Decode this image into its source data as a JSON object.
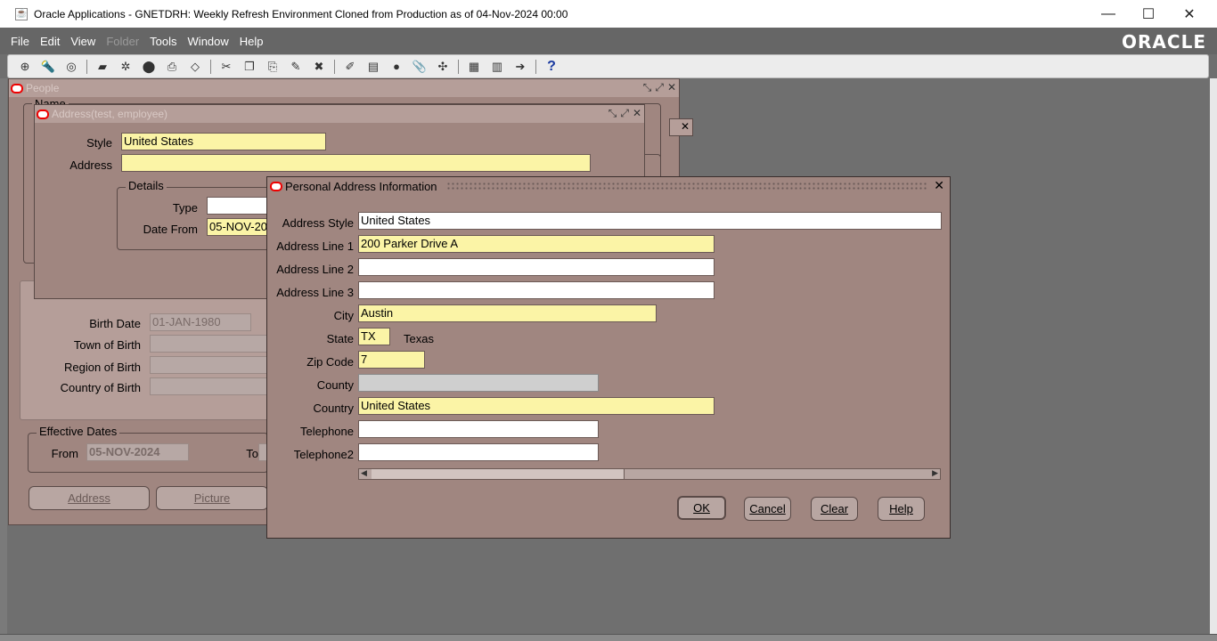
{
  "window": {
    "title": "Oracle Applications - GNETDRH: Weekly Refresh Environment Cloned from Production as of 04-Nov-2024 00:00",
    "minimize": "—",
    "maximize": "☐",
    "close": "✕"
  },
  "menu": {
    "items": [
      {
        "label": "File",
        "enabled": true
      },
      {
        "label": "Edit",
        "enabled": true
      },
      {
        "label": "View",
        "enabled": true
      },
      {
        "label": "Folder",
        "enabled": false
      },
      {
        "label": "Tools",
        "enabled": true
      },
      {
        "label": "Window",
        "enabled": true
      },
      {
        "label": "Help",
        "enabled": true
      }
    ],
    "logo": "ORACLE"
  },
  "people_window": {
    "title": "People",
    "name_label": "Name",
    "birth_date_label": "Birth Date",
    "birth_date_value": "01-JAN-1980",
    "town_of_birth_label": "Town of Birth",
    "region_of_birth_label": "Region of Birth",
    "country_of_birth_label": "Country of Birth",
    "effective_dates_label": "Effective Dates",
    "from_label": "From",
    "from_value": "05-NOV-2024",
    "to_label": "To",
    "address_button": "Address",
    "picture_button": "Picture"
  },
  "address_window": {
    "title": "Address(test, employee)",
    "style_label": "Style",
    "style_value": "United States",
    "address_label": "Address",
    "address_value": "",
    "details_label": "Details",
    "type_label": "Type",
    "type_value": "",
    "date_from_label": "Date From",
    "date_from_value": "05-NOV-20"
  },
  "dialog": {
    "title": "Personal Address Information",
    "address_style_label": "Address Style",
    "address_style_value": "United States",
    "line1_label": "Address Line 1",
    "line1_value": "200 Parker Drive A",
    "line2_label": "Address Line 2",
    "line2_value": "",
    "line3_label": "Address Line 3",
    "line3_value": "",
    "city_label": "City",
    "city_value": "Austin",
    "state_label": "State",
    "state_value": "TX",
    "state_name": "Texas",
    "zip_label": "Zip Code",
    "zip_value": "7",
    "county_label": "County",
    "county_value": "",
    "country_label": "Country",
    "country_value": "United States",
    "telephone_label": "Telephone",
    "telephone_value": "",
    "telephone2_label": "Telephone2",
    "telephone2_value": "",
    "ok_button": "OK",
    "cancel_button": "Cancel",
    "clear_button": "Clear",
    "help_button": "Help"
  },
  "colors": {
    "form_bg": "#a08680",
    "required_field": "#fbf4a6",
    "app_bg": "#6f6f6f"
  }
}
